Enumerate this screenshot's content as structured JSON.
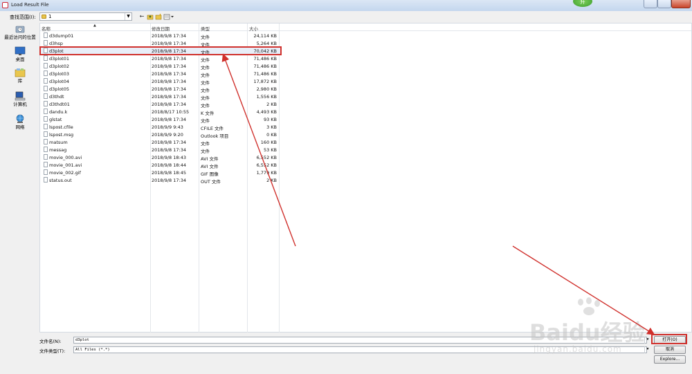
{
  "window": {
    "title": "Load Result File"
  },
  "badge": {
    "text": "升"
  },
  "lookin": {
    "label": "查找范围(I):",
    "value": "1"
  },
  "sidebar": {
    "items": [
      {
        "label": "最近访问的位置",
        "icon": "recent-places-icon"
      },
      {
        "label": "桌面",
        "icon": "desktop-icon"
      },
      {
        "label": "库",
        "icon": "libraries-icon"
      },
      {
        "label": "计算机",
        "icon": "computer-icon"
      },
      {
        "label": "网络",
        "icon": "network-icon"
      }
    ]
  },
  "columns": {
    "name": "名称",
    "date": "修改日期",
    "type": "类型",
    "size": "大小"
  },
  "files": [
    {
      "name": "d3dump01",
      "date": "2018/9/8 17:34",
      "type": "文件",
      "size": "24,114 KB"
    },
    {
      "name": "d3hsp",
      "date": "2018/9/8 17:34",
      "type": "文件",
      "size": "5,264 KB"
    },
    {
      "name": "d3plot",
      "date": "2018/9/8 17:34",
      "type": "文件",
      "size": "70,042 KB"
    },
    {
      "name": "d3plot01",
      "date": "2018/9/8 17:34",
      "type": "文件",
      "size": "71,486 KB"
    },
    {
      "name": "d3plot02",
      "date": "2018/9/8 17:34",
      "type": "文件",
      "size": "71,486 KB"
    },
    {
      "name": "d3plot03",
      "date": "2018/9/8 17:34",
      "type": "文件",
      "size": "71,486 KB"
    },
    {
      "name": "d3plot04",
      "date": "2018/9/8 17:34",
      "type": "文件",
      "size": "17,872 KB"
    },
    {
      "name": "d3plot05",
      "date": "2018/9/8 17:34",
      "type": "文件",
      "size": "2,980 KB"
    },
    {
      "name": "d3thdt",
      "date": "2018/9/8 17:34",
      "type": "文件",
      "size": "1,556 KB"
    },
    {
      "name": "d3thdt01",
      "date": "2018/9/8 17:34",
      "type": "文件",
      "size": "2 KB"
    },
    {
      "name": "dandu.k",
      "date": "2018/8/17 10:55",
      "type": "K 文件",
      "size": "4,493 KB"
    },
    {
      "name": "glstat",
      "date": "2018/9/8 17:34",
      "type": "文件",
      "size": "93 KB"
    },
    {
      "name": "lspost.cfile",
      "date": "2018/9/9 9:43",
      "type": "CFILE 文件",
      "size": "3 KB"
    },
    {
      "name": "lspost.msg",
      "date": "2018/9/9 9:20",
      "type": "Outlook 项目",
      "size": "0 KB"
    },
    {
      "name": "matsum",
      "date": "2018/9/8 17:34",
      "type": "文件",
      "size": "160 KB"
    },
    {
      "name": "messag",
      "date": "2018/9/8 17:34",
      "type": "文件",
      "size": "53 KB"
    },
    {
      "name": "movie_000.avi",
      "date": "2018/9/8 18:43",
      "type": "AVI 文件",
      "size": "6,552 KB"
    },
    {
      "name": "movie_001.avi",
      "date": "2018/9/8 18:44",
      "type": "AVI 文件",
      "size": "6,552 KB"
    },
    {
      "name": "movie_002.gif",
      "date": "2018/9/8 18:45",
      "type": "GIF 图像",
      "size": "1,779 KB"
    },
    {
      "name": "status.out",
      "date": "2018/9/8 17:34",
      "type": "OUT 文件",
      "size": "2 KB"
    }
  ],
  "selected_file": "d3plot",
  "filename": {
    "label": "文件名(N):",
    "value": "d3plot"
  },
  "filetype": {
    "label": "文件类型(T):",
    "value": "All Files (*.*)"
  },
  "buttons": {
    "open": "打开(O)",
    "cancel": "取消",
    "explore": "Explore..."
  },
  "watermark": {
    "text": "Baidu经验",
    "url": "jingyan.baidu.com"
  },
  "colors": {
    "annotation_red": "#d0302c",
    "titlebar": "#c4d7ee",
    "selection": "#e8eef8"
  }
}
